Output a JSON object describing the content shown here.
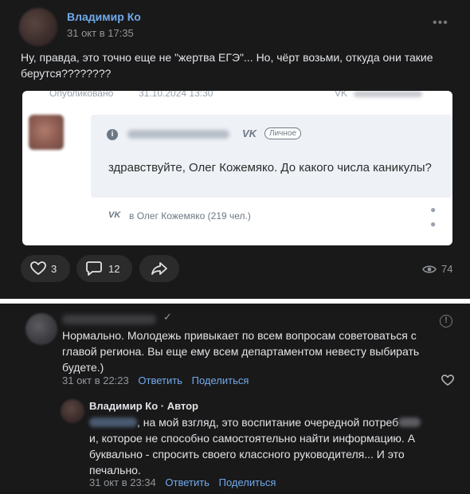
{
  "post": {
    "author": "Владимир Ко",
    "date": "31 окт в 17:35",
    "more": "•••",
    "text": "Ну, правда, это точно еще не \"жертва ЕГЭ\"... Но, чёрт возьми, откуда они такие берутся????????",
    "screenshot": {
      "cut_label": "Опубликовано",
      "cut_date": "31.10.2024 13:30",
      "vk_logo": "VK",
      "badge": "Личное",
      "message": "здравствуйте, Олег Кожемяко. До какого числа каникулы?",
      "source": "в Олег Кожемяко (219 чел.)"
    },
    "actions": {
      "likes": "3",
      "comments": "12",
      "views": "74"
    }
  },
  "comment": {
    "check": "✓",
    "report": "!",
    "text": "Нормально. Молодежь привыкает по всем вопросам советоваться с главой региона. Вы еще ему всем департаментом невесту выбирать будете.)",
    "date": "31 окт в 22:23",
    "reply_link": "Ответить",
    "share_link": "Поделиться"
  },
  "reply": {
    "author": "Владимир Ко · Автор",
    "text_part1": ", на мой взгляд, это воспитание очередной потреб",
    "text_part2": "и, которое не способно самостоятельно найти информацию. А буквально - спросить своего классного руководителя... И это печально.",
    "date": "31 окт в 23:34",
    "reply_link": "Ответить",
    "share_link": "Поделиться"
  },
  "colors": {
    "background": "#19191a",
    "link": "#71aaeb",
    "text": "#e1e3e6",
    "muted": "#939699"
  }
}
